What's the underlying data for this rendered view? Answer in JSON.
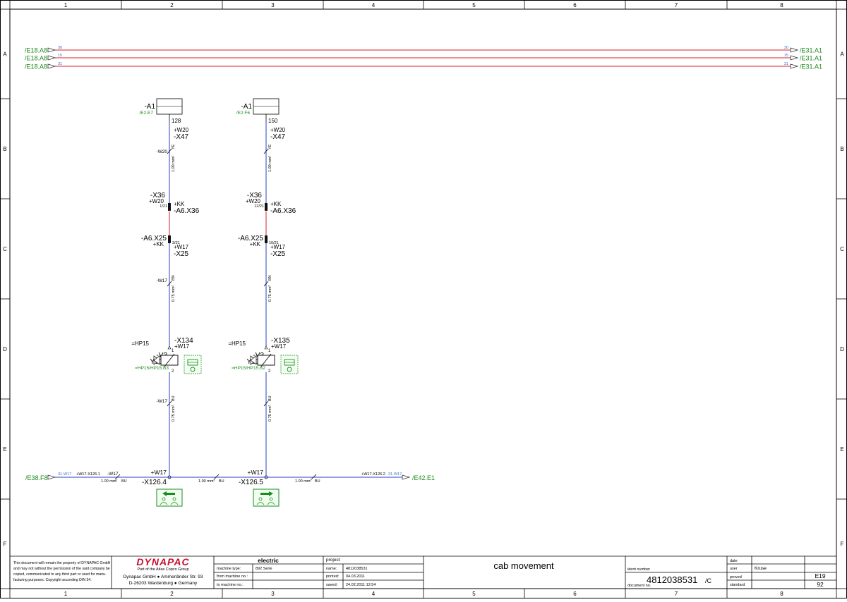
{
  "grid": {
    "columns": [
      "1",
      "2",
      "3",
      "4",
      "5",
      "6",
      "7",
      "8"
    ],
    "rows": [
      "A",
      "B",
      "C",
      "D",
      "E",
      "F"
    ]
  },
  "colors": {
    "frame": "#000000",
    "wire_red": "#d8202a",
    "wire_blue": "#2a3fc8",
    "ref_green": "#1f8a1f",
    "label_blue": "#3a6fd0",
    "logo_red": "#c8102e"
  },
  "icons": [
    "seat-move-left-icon",
    "seat-move-right-icon",
    "solenoid-valve-icon",
    "hydraulic-valve-symbol-icon",
    "connector-terminal-icon",
    "arrow-connector-icon"
  ],
  "busbar": {
    "lines": [
      {
        "left_ref": "/E18.A8",
        "left_num": "30",
        "right_num": "30",
        "right_ref": "/E31.A1"
      },
      {
        "left_ref": "/E18.A8",
        "left_num": "15",
        "right_num": "15",
        "right_ref": "/E31.A1"
      },
      {
        "left_ref": "/E18.A8",
        "left_num": "31",
        "right_num": "31",
        "right_ref": "/E31.A1"
      }
    ]
  },
  "circuits": [
    {
      "module_name": "-A1",
      "module_ref": "/E2.E7",
      "pin": "128",
      "x47_loc": "+W20",
      "x47_name": "-X47",
      "wire_top_id": "-W20",
      "wire_top_color": "YE",
      "wire_top_size": "1.00 mm²",
      "x36_name": "-X36",
      "x36_loc": "+W20",
      "x36_pin": "1/21",
      "x36_kk": "+KK",
      "x36_dest": "-A6.X36",
      "x25_name": "-A6.X25",
      "x25_kk": "+KK",
      "x25_pin": "3/21",
      "x25_loc": "+W17",
      "x25_dest": "-X25",
      "wire_mid_id": "-W17",
      "wire_mid_color": "BN",
      "wire_mid_size": "0.75 mm²",
      "hp": "=HP15",
      "valve_v": "-V3",
      "valve_y": "Y30A",
      "valve_ref": "=HP15/HP15.B3",
      "xval_name": "-X134",
      "xval_loc": "+W17",
      "pin1": "1",
      "pin2": "2",
      "wire_low_id": "-W17",
      "wire_low_color": "BU",
      "wire_low_size": "0.75 mm²",
      "junction_loc": "+W17",
      "junction_name": "-X126.4"
    },
    {
      "module_name": "-A1",
      "module_ref": "/E2.F6",
      "pin": "150",
      "x47_loc": "+W20",
      "x47_name": "-X47",
      "wire_top_id": "",
      "wire_top_color": "YE",
      "wire_top_size": "1.00 mm²",
      "x36_name": "-X36",
      "x36_loc": "+W20",
      "x36_pin": "12/21",
      "x36_kk": "+KK",
      "x36_dest": "-A6.X36",
      "x25_name": "-A6.X25",
      "x25_kk": "+KK",
      "x25_pin": "10/21",
      "x25_loc": "+W17",
      "x25_dest": "-X25",
      "wire_mid_id": "",
      "wire_mid_color": "BN",
      "wire_mid_size": "0.75 mm²",
      "hp": "=HP15",
      "valve_v": "-V3",
      "valve_y": "Y30B",
      "valve_ref": "=HP15/HP15.B2",
      "xval_name": "-X135",
      "xval_loc": "+W17",
      "pin1": "1",
      "pin2": "2",
      "wire_low_id": "",
      "wire_low_color": "BU",
      "wire_low_size": "0.75 mm²",
      "junction_loc": "+W17",
      "junction_name": "-X126.5"
    }
  ],
  "bottom_wire": {
    "left_ref": "/E38.F8",
    "left_num": "31-W17",
    "left_conn": "+W17-X126.1",
    "left_wire_id": "-W17",
    "seg1_size": "1.00 mm²",
    "seg1_color": "BU",
    "seg2_size": "1.00 mm²",
    "seg2_color": "BU",
    "seg3_size": "1.00 mm²",
    "seg3_color": "BU",
    "right_conn": "+W17-X126.2",
    "right_num": "31-W17",
    "right_ref": "/E42.E1"
  },
  "title_block": {
    "disclaimer": [
      "This document will remain the property of DYNAPAC GmbH",
      "and may not without the permission of the said company be",
      "copied, communicated to any third part or used for manu-",
      "facturing purposes. Copyright according DIN 34."
    ],
    "logo": "DYNAPAC",
    "logo_sub": "Part of the Atlas Copco Group",
    "company_line1": "Dynapac GmbH ● Ammerländer Str. 93",
    "company_line2": "D-26203 Wardenburg ● Germany",
    "section": "electric",
    "machine_type_label": "machine type:",
    "machine_type": "892 Serie",
    "from_machine_label": "from machine no.:",
    "to_machine_label": "to machine no.:",
    "project_label": "project",
    "name_label": "name:",
    "name_value": "4812038531",
    "printed_label": "printed:",
    "printed_value": "04.03.2011",
    "saved_label": "saved:",
    "saved_value": "24.02.2011  12:54",
    "page_title": "cab movement",
    "ident_label": "ident number",
    "document_label": "document no.",
    "document_no": "4812038531",
    "document_suffix": "/C",
    "date_label": "date",
    "user_label": "user",
    "user_value": "Kruse",
    "proved_label": "proved",
    "standard_label": "standard",
    "sheet_code": "E19",
    "sheet_no": "92"
  }
}
